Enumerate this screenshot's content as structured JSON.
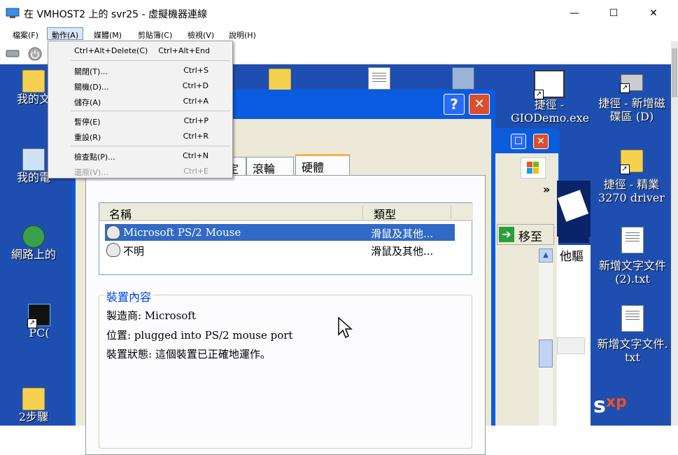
{
  "window": {
    "title": "在 VMHOST2 上的 svr25 - 虛擬機器連線",
    "minimize": "—",
    "maximize": "☐",
    "close": "✕"
  },
  "menubar": [
    "檔案(F)",
    "動作(A)",
    "媒體(M)",
    "剪貼簿(C)",
    "檢視(V)",
    "說明(H)"
  ],
  "dropdown": {
    "items": [
      {
        "label": "Ctrl+Alt+Delete(C)",
        "shortcut": "Ctrl+Alt+End",
        "disabled": false
      },
      {
        "label": "關閉(T)...",
        "shortcut": "Ctrl+S",
        "disabled": false
      },
      {
        "label": "關機(D)...",
        "shortcut": "Ctrl+D",
        "disabled": false
      },
      {
        "label": "儲存(A)",
        "shortcut": "Ctrl+A",
        "disabled": false
      },
      {
        "label": "暫停(E)",
        "shortcut": "Ctrl+P",
        "disabled": false
      },
      {
        "label": "重設(R)",
        "shortcut": "Ctrl+R",
        "disabled": false
      },
      {
        "label": "檢查點(P)...",
        "shortcut": "Ctrl+N",
        "disabled": false
      },
      {
        "label": "還原(V)...",
        "shortcut": "Ctrl+E",
        "disabled": true
      }
    ]
  },
  "desktop": {
    "icons_left": [
      "我的文",
      "我的電",
      "網路上的",
      "PC(",
      "2步驟"
    ],
    "icons_right": [
      {
        "label1": "捷徑 -",
        "label2": "GIODemo.exe"
      },
      {
        "label1": "捷徑 - 新增磁",
        "label2": "碟區 (D)"
      },
      {
        "label1": "捷徑 - 精業",
        "label2": "3270 driver"
      },
      {
        "label1": "新增文字文件",
        "label2": "(2).txt"
      },
      {
        "label1": "新增文字文件.",
        "label2": "txt"
      }
    ]
  },
  "explorer": {
    "goto": "移至",
    "other_drivers": "他驅",
    "chevron": "»"
  },
  "dialog": {
    "help_btn": "?",
    "close_btn": "✕",
    "tabs": [
      "定",
      "滾輪",
      "硬體"
    ],
    "list_headers": {
      "name": "名稱",
      "type": "類型"
    },
    "devices": [
      {
        "name": "Microsoft PS/2 Mouse",
        "type": "滑鼠及其他...",
        "selected": true
      },
      {
        "name": "不明",
        "type": "滑鼠及其他...",
        "selected": false
      }
    ],
    "props_legend": "裝置內容",
    "manufacturer": "製造商: Microsoft",
    "location": "位置: plugged into PS/2 mouse port",
    "status": "裝置狀態: 這個裝置已正確地運作。"
  }
}
